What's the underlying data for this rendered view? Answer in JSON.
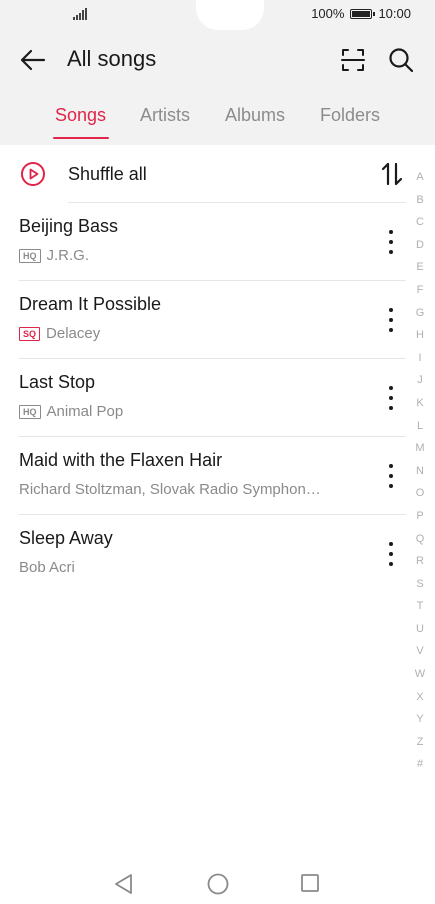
{
  "status": {
    "battery": "100%",
    "time": "10:00"
  },
  "header": {
    "title": "All songs"
  },
  "tabs": [
    "Songs",
    "Artists",
    "Albums",
    "Folders"
  ],
  "active_tab": "Songs",
  "shuffle": {
    "label": "Shuffle all"
  },
  "songs": [
    {
      "title": "Beijing Bass",
      "badge": "HQ",
      "artist": "J.R.G."
    },
    {
      "title": "Dream It Possible",
      "badge": "SQ",
      "artist": "Delacey"
    },
    {
      "title": "Last Stop",
      "badge": "HQ",
      "artist": "Animal Pop"
    },
    {
      "title": "Maid with the Flaxen Hair",
      "badge": "",
      "artist": "Richard Stoltzman, Slovak Radio Symphon…"
    },
    {
      "title": "Sleep Away",
      "badge": "",
      "artist": "Bob Acri"
    }
  ],
  "alphabet": [
    "A",
    "B",
    "C",
    "D",
    "E",
    "F",
    "G",
    "H",
    "I",
    "J",
    "K",
    "L",
    "M",
    "N",
    "O",
    "P",
    "Q",
    "R",
    "S",
    "T",
    "U",
    "V",
    "W",
    "X",
    "Y",
    "Z",
    "#"
  ],
  "colors": {
    "accent": "#e0244a",
    "header_bg": "#f2f2f2"
  }
}
